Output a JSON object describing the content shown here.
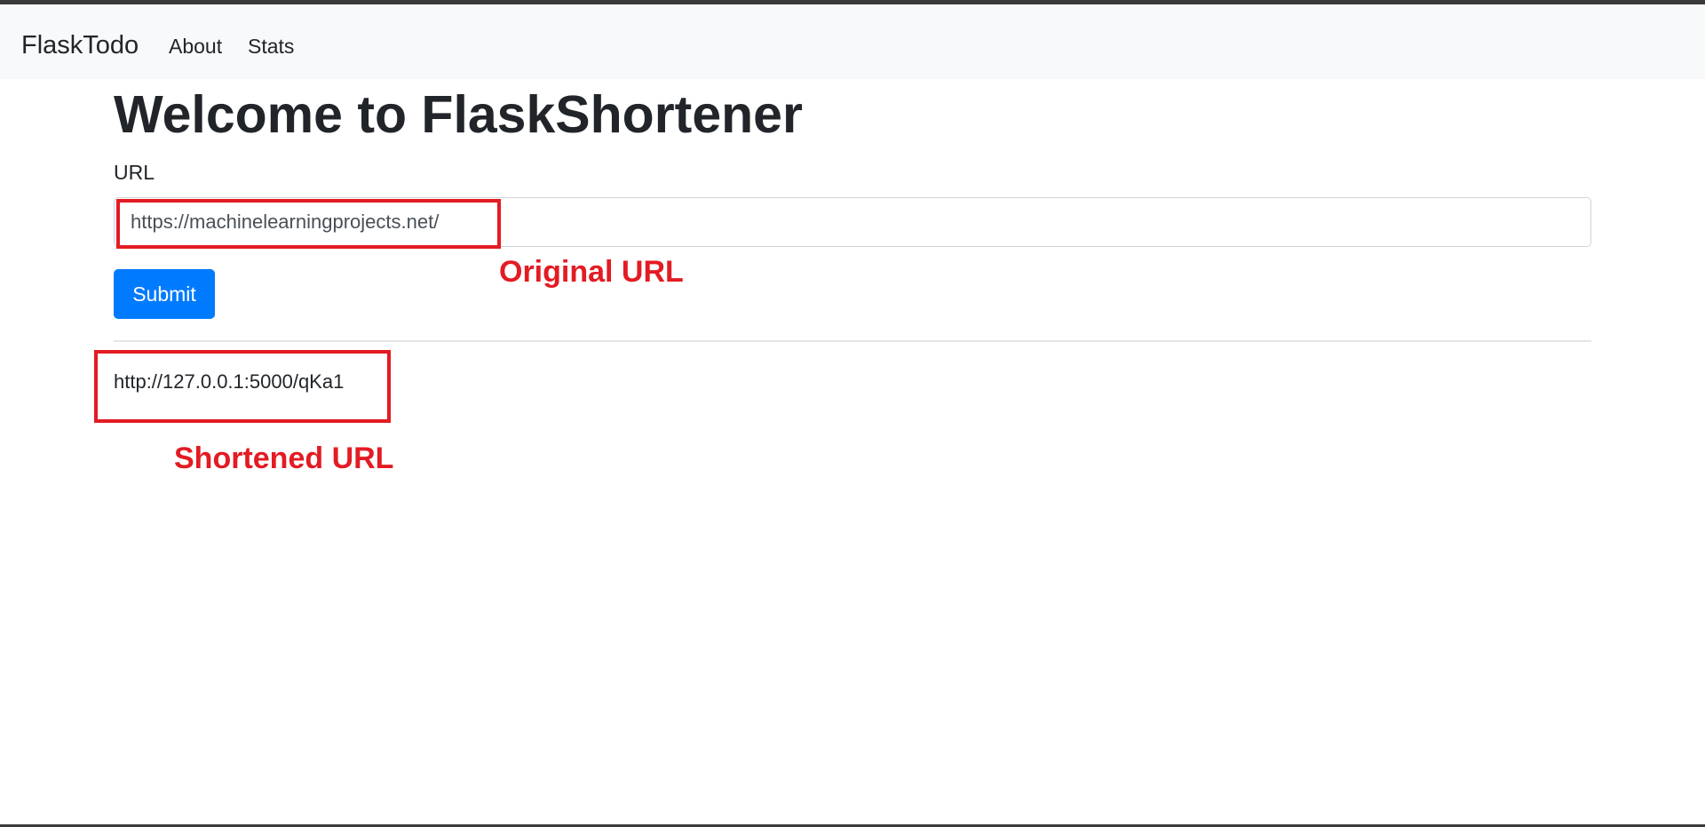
{
  "navbar": {
    "brand": "FlaskTodo",
    "links": [
      {
        "label": "About"
      },
      {
        "label": "Stats"
      }
    ]
  },
  "main": {
    "title": "Welcome to FlaskShortener",
    "url_label": "URL",
    "url_input_value": "https://machinelearningprojects.net/",
    "submit_label": "Submit",
    "shortened_url": "http://127.0.0.1:5000/qKa1"
  },
  "annotations": {
    "color": "#e31b23",
    "original_label": "Original URL",
    "shortened_label": "Shortened URL"
  },
  "colors": {
    "navbar_bg": "#f8f9fa",
    "primary": "#007bff",
    "text": "#212529"
  }
}
